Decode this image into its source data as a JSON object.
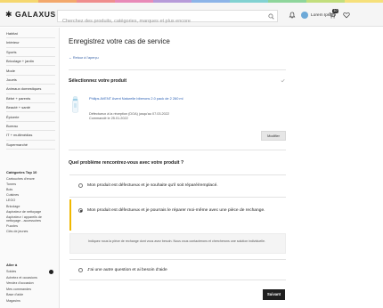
{
  "brand": {
    "logo_text": "GALAXUS",
    "rainbow_colors": [
      "#f5d76e",
      "#f3a86b",
      "#ef8e8e",
      "#e88ab8",
      "#b79bd9",
      "#8cb4e8",
      "#82d2d2",
      "#8ed59b",
      "#c2de7d",
      "#f6e07a"
    ]
  },
  "header": {
    "search_placeholder": "Cherchez des produits, catégories, marques et plus encore",
    "cart_count": "10",
    "user_name": "Lorem Ipsum"
  },
  "sidebar": {
    "nav_items": [
      "Habitat",
      "Intérieur",
      "Sports",
      "Bricolage + jardin",
      "Mode",
      "Jouets",
      "Animaux domestiques",
      "Bébé + parents",
      "Beauté + santé",
      "Épicerie",
      "Bureau",
      "IT + multimédias",
      "Supermarché"
    ],
    "categories_title": "Catégories Top 10",
    "categories": [
      "Cartouches d'encre",
      "Toners",
      "Bois",
      "Cuisines",
      "LEGO",
      "Bricolage",
      "Aspirateur de nettoyage",
      "Aspirateur / appareils de nettoyage - accessoires",
      "Puzzles",
      "Clés de jeunes"
    ],
    "account_title": "Aller à",
    "account_items": [
      "Soldes",
      "Achetez et occasions",
      "Vendez d'occasion",
      "Mes commandes",
      "Base d'aide",
      "Magasins"
    ]
  },
  "main": {
    "title": "Enregistrez votre cas de service",
    "back_link": "← Retour à l'aperçu",
    "product_section": {
      "title": "Sélectionnez votre produit",
      "product_name": "Philips AVENT Avent Naturelle biberons 2.0 pack de 2 260 ml",
      "defect_line": "Défectueux à la réception (DOA) jusqu'au 07.03.2022",
      "order_line": "Commandé le 25.01.2022",
      "modify_label": "Modifier"
    },
    "problem_section": {
      "title": "Quel problème rencontrez-vous avec votre produit ?",
      "options": [
        {
          "label": "Mon produit est défectueux et je souhaite qu'il soit réparé/remplacé."
        },
        {
          "label": "Mon produit est défectueux et je pourrais le réparer moi-même avec une pièce de rechange."
        },
        {
          "label": "J'ai une autre question et ai besoin d'aide"
        }
      ],
      "selected_index": 1,
      "hint": "Indiquez nous la pièce de rechange dont vous avez besoin. Nous vous contacterons et chercherons une solution individuelle."
    },
    "next_label": "Suivant"
  }
}
